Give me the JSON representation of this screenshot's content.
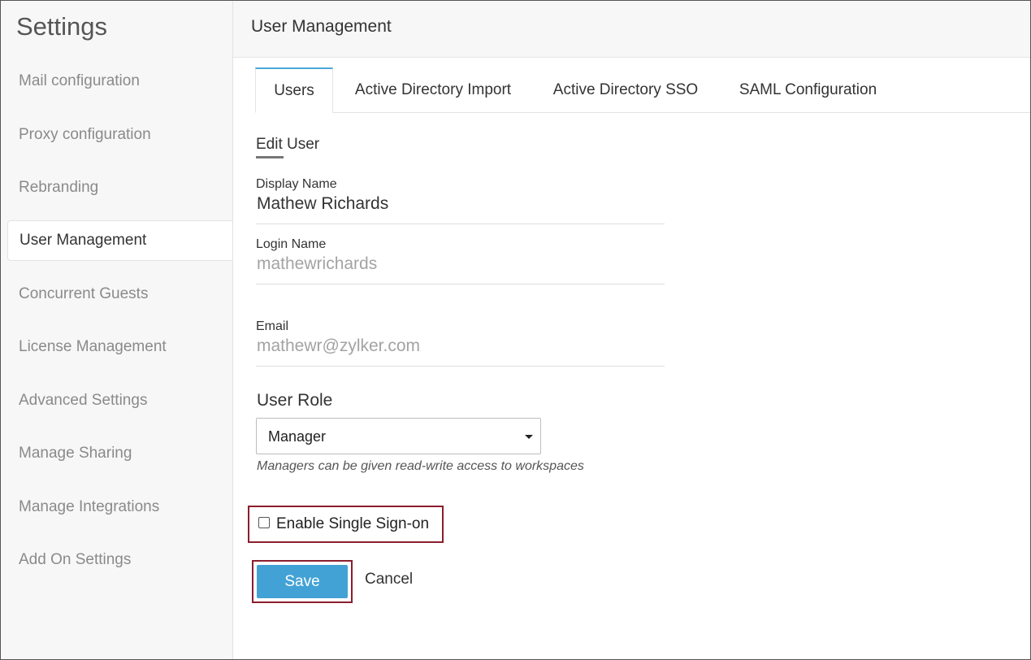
{
  "sidebar": {
    "title": "Settings",
    "items": [
      {
        "label": "Mail configuration"
      },
      {
        "label": "Proxy configuration"
      },
      {
        "label": "Rebranding"
      },
      {
        "label": "User Management"
      },
      {
        "label": "Concurrent Guests"
      },
      {
        "label": "License Management"
      },
      {
        "label": "Advanced Settings"
      },
      {
        "label": "Manage Sharing"
      },
      {
        "label": "Manage Integrations"
      },
      {
        "label": "Add On Settings"
      }
    ],
    "active_item": "User Management"
  },
  "header": {
    "title": "User Management"
  },
  "tabs": [
    {
      "label": "Users"
    },
    {
      "label": "Active Directory Import"
    },
    {
      "label": "Active Directory SSO"
    },
    {
      "label": "SAML Configuration"
    }
  ],
  "active_tab": "Users",
  "form": {
    "section_title": "Edit User",
    "display_name": {
      "label": "Display Name",
      "value": "Mathew Richards"
    },
    "login_name": {
      "label": "Login Name",
      "value": "mathewrichards"
    },
    "email": {
      "label": "Email",
      "value": "mathewr@zylker.com"
    },
    "user_role": {
      "label": "User Role",
      "selected": "Manager",
      "hint": "Managers can be given read-write access to workspaces"
    },
    "sso": {
      "label": "Enable Single Sign-on",
      "checked": false
    },
    "save_label": "Save",
    "cancel_label": "Cancel"
  },
  "colors": {
    "accent": "#43a2d5",
    "highlight_border": "#8b1e2d"
  }
}
